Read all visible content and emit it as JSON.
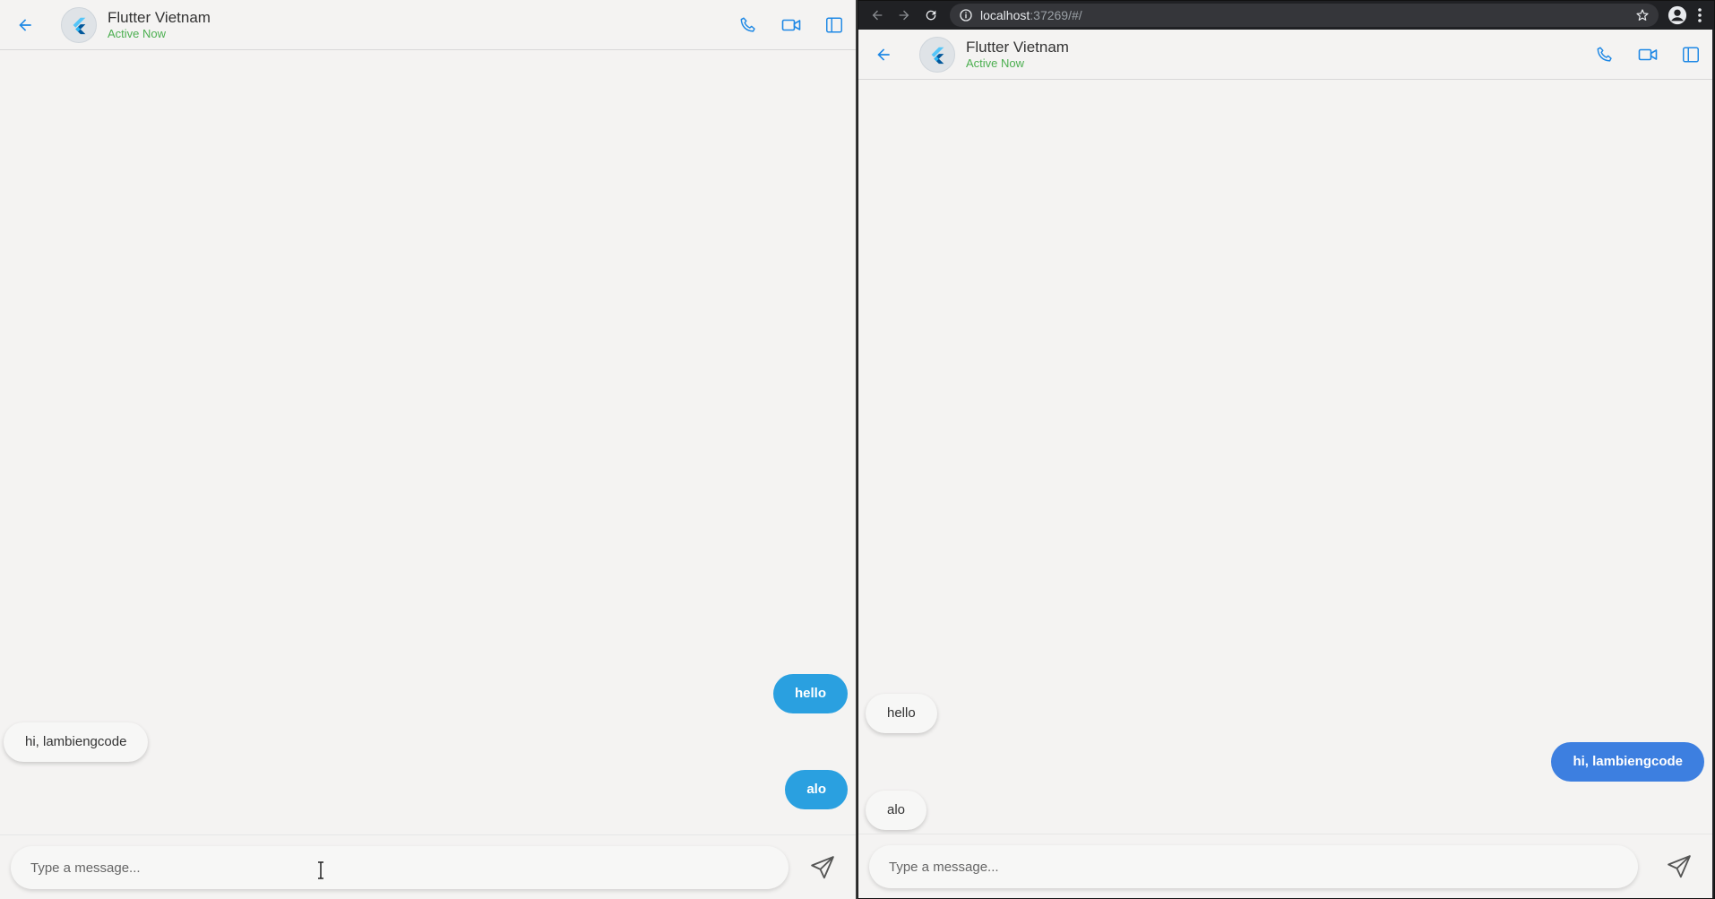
{
  "colors": {
    "accent_blue": "#1e88e5",
    "status_green": "#4caf50",
    "bubble_out_left": "#2aa0e0",
    "bubble_out_right": "#3d7fe0"
  },
  "left": {
    "chat": {
      "title": "Flutter Vietnam",
      "status": "Active Now",
      "icons": [
        "arrow-back-icon",
        "phone-icon",
        "video-icon",
        "sidebar-icon"
      ]
    },
    "messages": [
      {
        "text": "hello",
        "side": "out"
      },
      {
        "text": "hi, lambiengcode",
        "side": "in"
      },
      {
        "text": "alo",
        "side": "out"
      }
    ],
    "composer": {
      "placeholder": "Type a message...",
      "value": ""
    }
  },
  "browser": {
    "url_host": "localhost",
    "url_rest": ":37269/#/"
  },
  "right": {
    "chat": {
      "title": "Flutter Vietnam",
      "status": "Active Now"
    },
    "messages": [
      {
        "text": "hello",
        "side": "in"
      },
      {
        "text": "hi, lambiengcode",
        "side": "out"
      },
      {
        "text": "alo",
        "side": "in"
      }
    ],
    "composer": {
      "placeholder": "Type a message...",
      "value": ""
    }
  }
}
